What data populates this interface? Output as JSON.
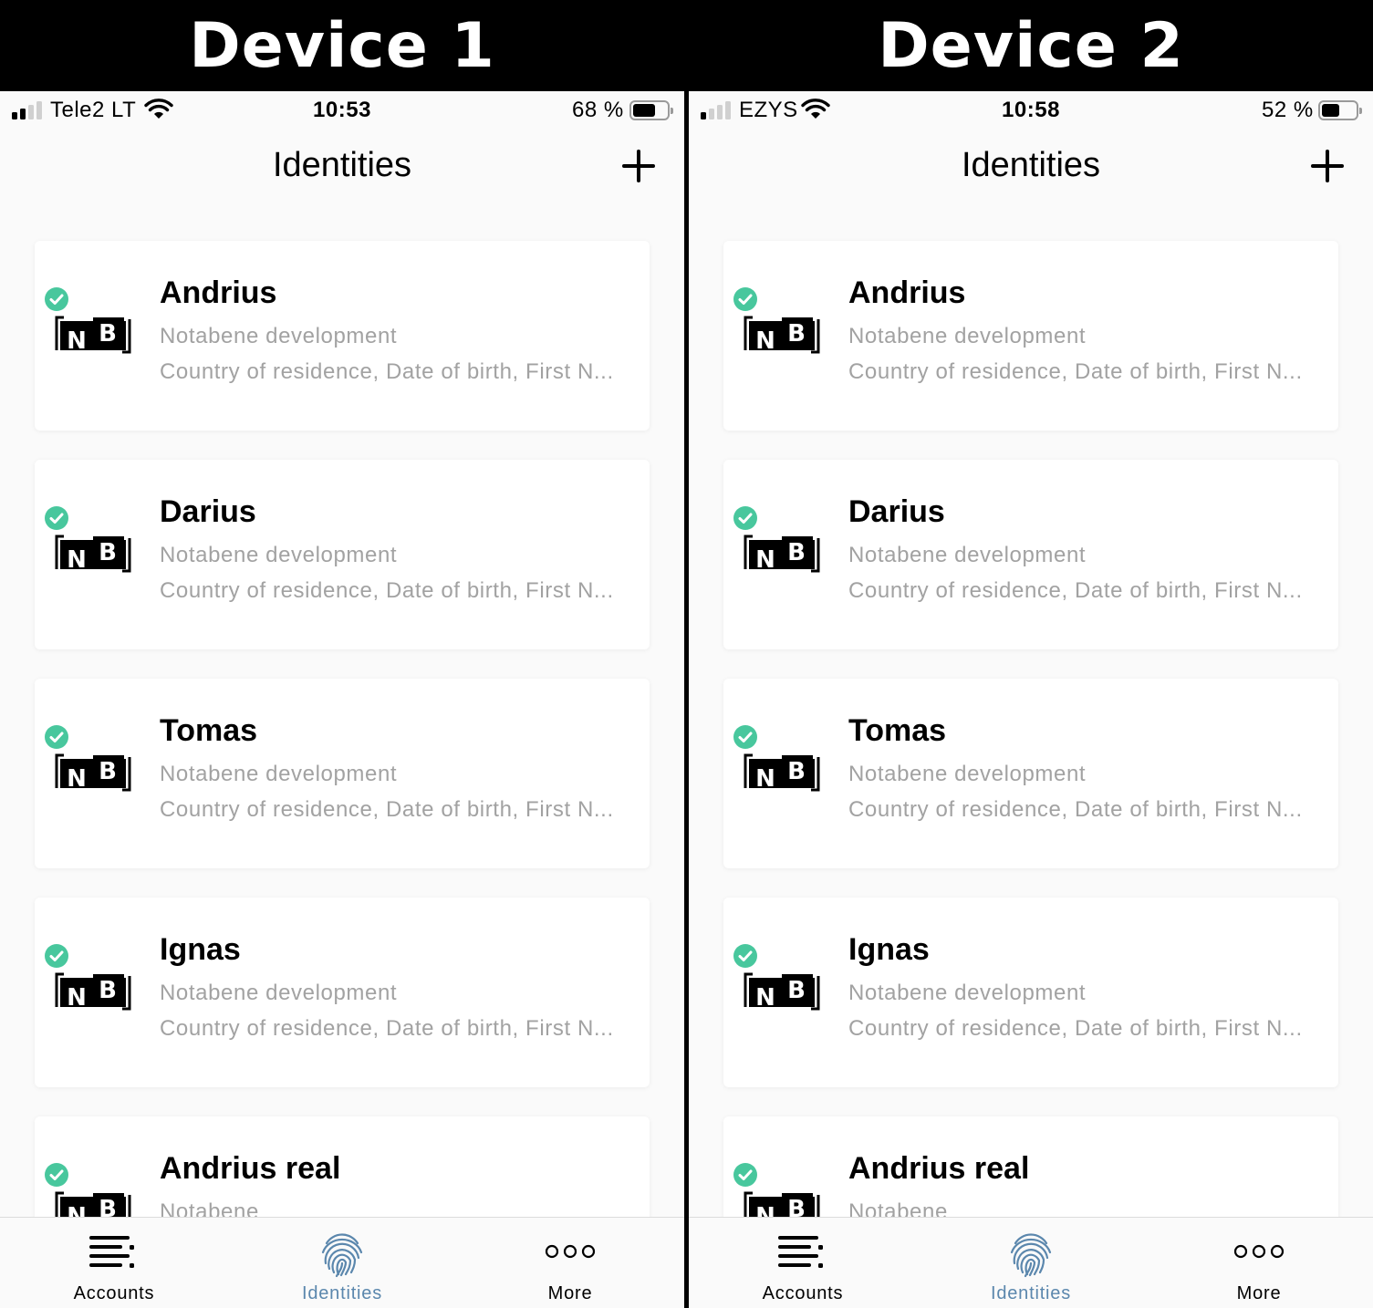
{
  "labels": {
    "device1": "Device 1",
    "device2": "Device 2"
  },
  "devices": [
    {
      "carrier": "Tele2 LT",
      "time": "10:53",
      "battery_pct": "68 %",
      "battery_level": 0.68,
      "signal_bars": 2,
      "title": "Identities",
      "cards": [
        {
          "name": "Andrius",
          "org": "Notabene development",
          "attrs": "Country of residence, Date of birth, First N..."
        },
        {
          "name": "Darius",
          "org": "Notabene development",
          "attrs": "Country of residence, Date of birth, First N..."
        },
        {
          "name": "Tomas",
          "org": "Notabene development",
          "attrs": "Country of residence, Date of birth, First N..."
        },
        {
          "name": "Ignas",
          "org": "Notabene development",
          "attrs": "Country of residence, Date of birth, First N..."
        },
        {
          "name": "Andrius real",
          "org": "Notabene",
          "attrs": ""
        }
      ],
      "tabs": [
        {
          "label": "Accounts",
          "icon": "accounts-list-icon"
        },
        {
          "label": "Identities",
          "icon": "fingerprint-icon"
        },
        {
          "label": "More",
          "icon": "more-dots-icon"
        }
      ]
    },
    {
      "carrier": "EZYS",
      "time": "10:58",
      "battery_pct": "52 %",
      "battery_level": 0.52,
      "signal_bars": 1,
      "title": "Identities",
      "cards": [
        {
          "name": "Andrius",
          "org": "Notabene development",
          "attrs": "Country of residence, Date of birth, First N..."
        },
        {
          "name": "Darius",
          "org": "Notabene development",
          "attrs": "Country of residence, Date of birth, First N..."
        },
        {
          "name": "Tomas",
          "org": "Notabene development",
          "attrs": "Country of residence, Date of birth, First N..."
        },
        {
          "name": "Ignas",
          "org": "Notabene development",
          "attrs": "Country of residence, Date of birth, First N..."
        },
        {
          "name": "Andrius real",
          "org": "Notabene",
          "attrs": ""
        }
      ],
      "tabs": [
        {
          "label": "Accounts",
          "icon": "accounts-list-icon"
        },
        {
          "label": "Identities",
          "icon": "fingerprint-icon"
        },
        {
          "label": "More",
          "icon": "more-dots-icon"
        }
      ]
    }
  ],
  "colors": {
    "check": "#48c79d",
    "active_tab": "#5b87ad",
    "secondary_text": "#a2a2a2"
  }
}
